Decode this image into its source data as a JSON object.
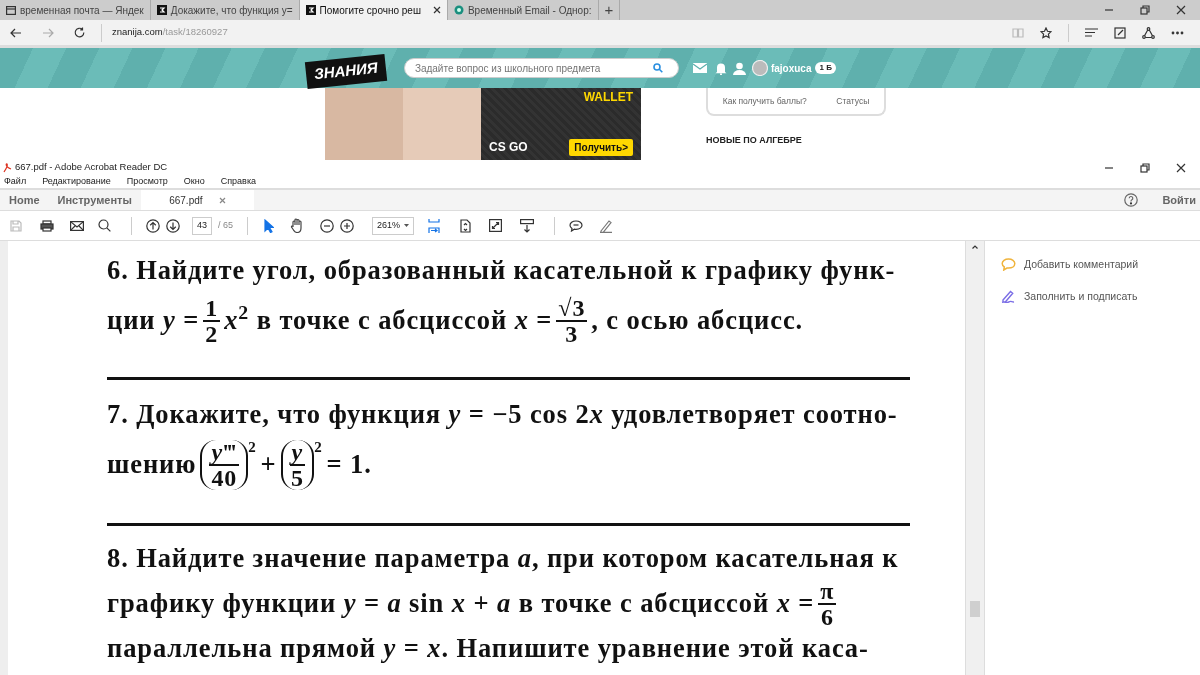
{
  "browser": {
    "tabs": [
      {
        "title": "временная почта — Яндек",
        "selected": false
      },
      {
        "title": "Докажите, что функция у=",
        "selected": false
      },
      {
        "title": "Помогите срочно реш",
        "selected": true
      },
      {
        "title": "Временный Email - Однор:",
        "selected": false
      }
    ],
    "new_tab": "+",
    "url_host": "znanija.com",
    "url_path": "/task/18260927"
  },
  "website": {
    "logo": "ЗНАНИЯ",
    "search_placeholder": "Задайте вопрос из школьного предмета",
    "username": "fajoxuca",
    "points": "1 Б",
    "ad_title": "WALLET",
    "ad_logo": "CS GO",
    "ad_button": "Получить>",
    "card_links": [
      "Как получить баллы?",
      "Статусы"
    ],
    "section_heading": "НОВЫЕ ПО АЛГЕБРЕ"
  },
  "acrobat": {
    "title": "667.pdf - Adobe Acrobat Reader DC",
    "menu": [
      "Файл",
      "Редактирование",
      "Просмотр",
      "Окно",
      "Справка"
    ],
    "tabs": [
      {
        "label": "Home",
        "selected": false
      },
      {
        "label": "Инструменты",
        "selected": false
      },
      {
        "label": "667.pdf",
        "selected": true
      }
    ],
    "sign_in": "Войти",
    "save_disabled": true,
    "page_current": "43",
    "page_total": "/ 65",
    "zoom": "261%",
    "tools": [
      {
        "kind": "pointer",
        "selected": true
      },
      {
        "kind": "hand",
        "selected": false
      }
    ]
  },
  "document": {
    "problems": [
      {
        "lines": [
          [
            {
              "kind": "text",
              "text": "6. Найдите угол, образованный касательной к графику функ-"
            }
          ],
          [
            {
              "kind": "text",
              "text": "ции *y* = "
            },
            {
              "kind": "frac",
              "num": "1",
              "den": "2"
            },
            {
              "kind": "text",
              "text": "*x*$^{2}$ в точке с абсциссой *x* = "
            },
            {
              "kind": "frac",
              "num": "√3",
              "den": "3"
            },
            {
              "kind": "text",
              "text": ", с осью абсцисс."
            }
          ]
        ]
      },
      {
        "lines": [
          [
            {
              "kind": "text",
              "text": "7. Докажите, что функция *y* = −5 cos 2"
            },
            {
              "kind": "text",
              "text": "*x* удовлетворяет соотно-"
            }
          ],
          [
            {
              "kind": "text",
              "text": "шению "
            },
            {
              "kind": "pfrac",
              "num": "*y*‴",
              "den": "40",
              "power": "2"
            },
            {
              "kind": "text",
              "text": " + "
            },
            {
              "kind": "pfrac",
              "num": "*y*",
              "den": "5",
              "power": "2"
            },
            {
              "kind": "text",
              "text": " = 1."
            }
          ]
        ]
      },
      {
        "lines": [
          [
            {
              "kind": "text",
              "text": "8. Найдите значение параметра *a*, при котором касательная к"
            }
          ],
          [
            {
              "kind": "text",
              "text": "графику функции *y* = *a* sin *x* + *a* в точке с абсциссой *x* = "
            },
            {
              "kind": "frac",
              "num": "π",
              "den": "6"
            }
          ],
          [
            {
              "kind": "text",
              "text": "параллельна прямой *y* = *x*. Напишите уравнение этой каса-"
            }
          ]
        ]
      }
    ]
  },
  "side_panel": [
    {
      "kind": "comment",
      "label": "Добавить комментарий"
    },
    {
      "kind": "sign",
      "label": "Заполнить и подписать"
    }
  ]
}
